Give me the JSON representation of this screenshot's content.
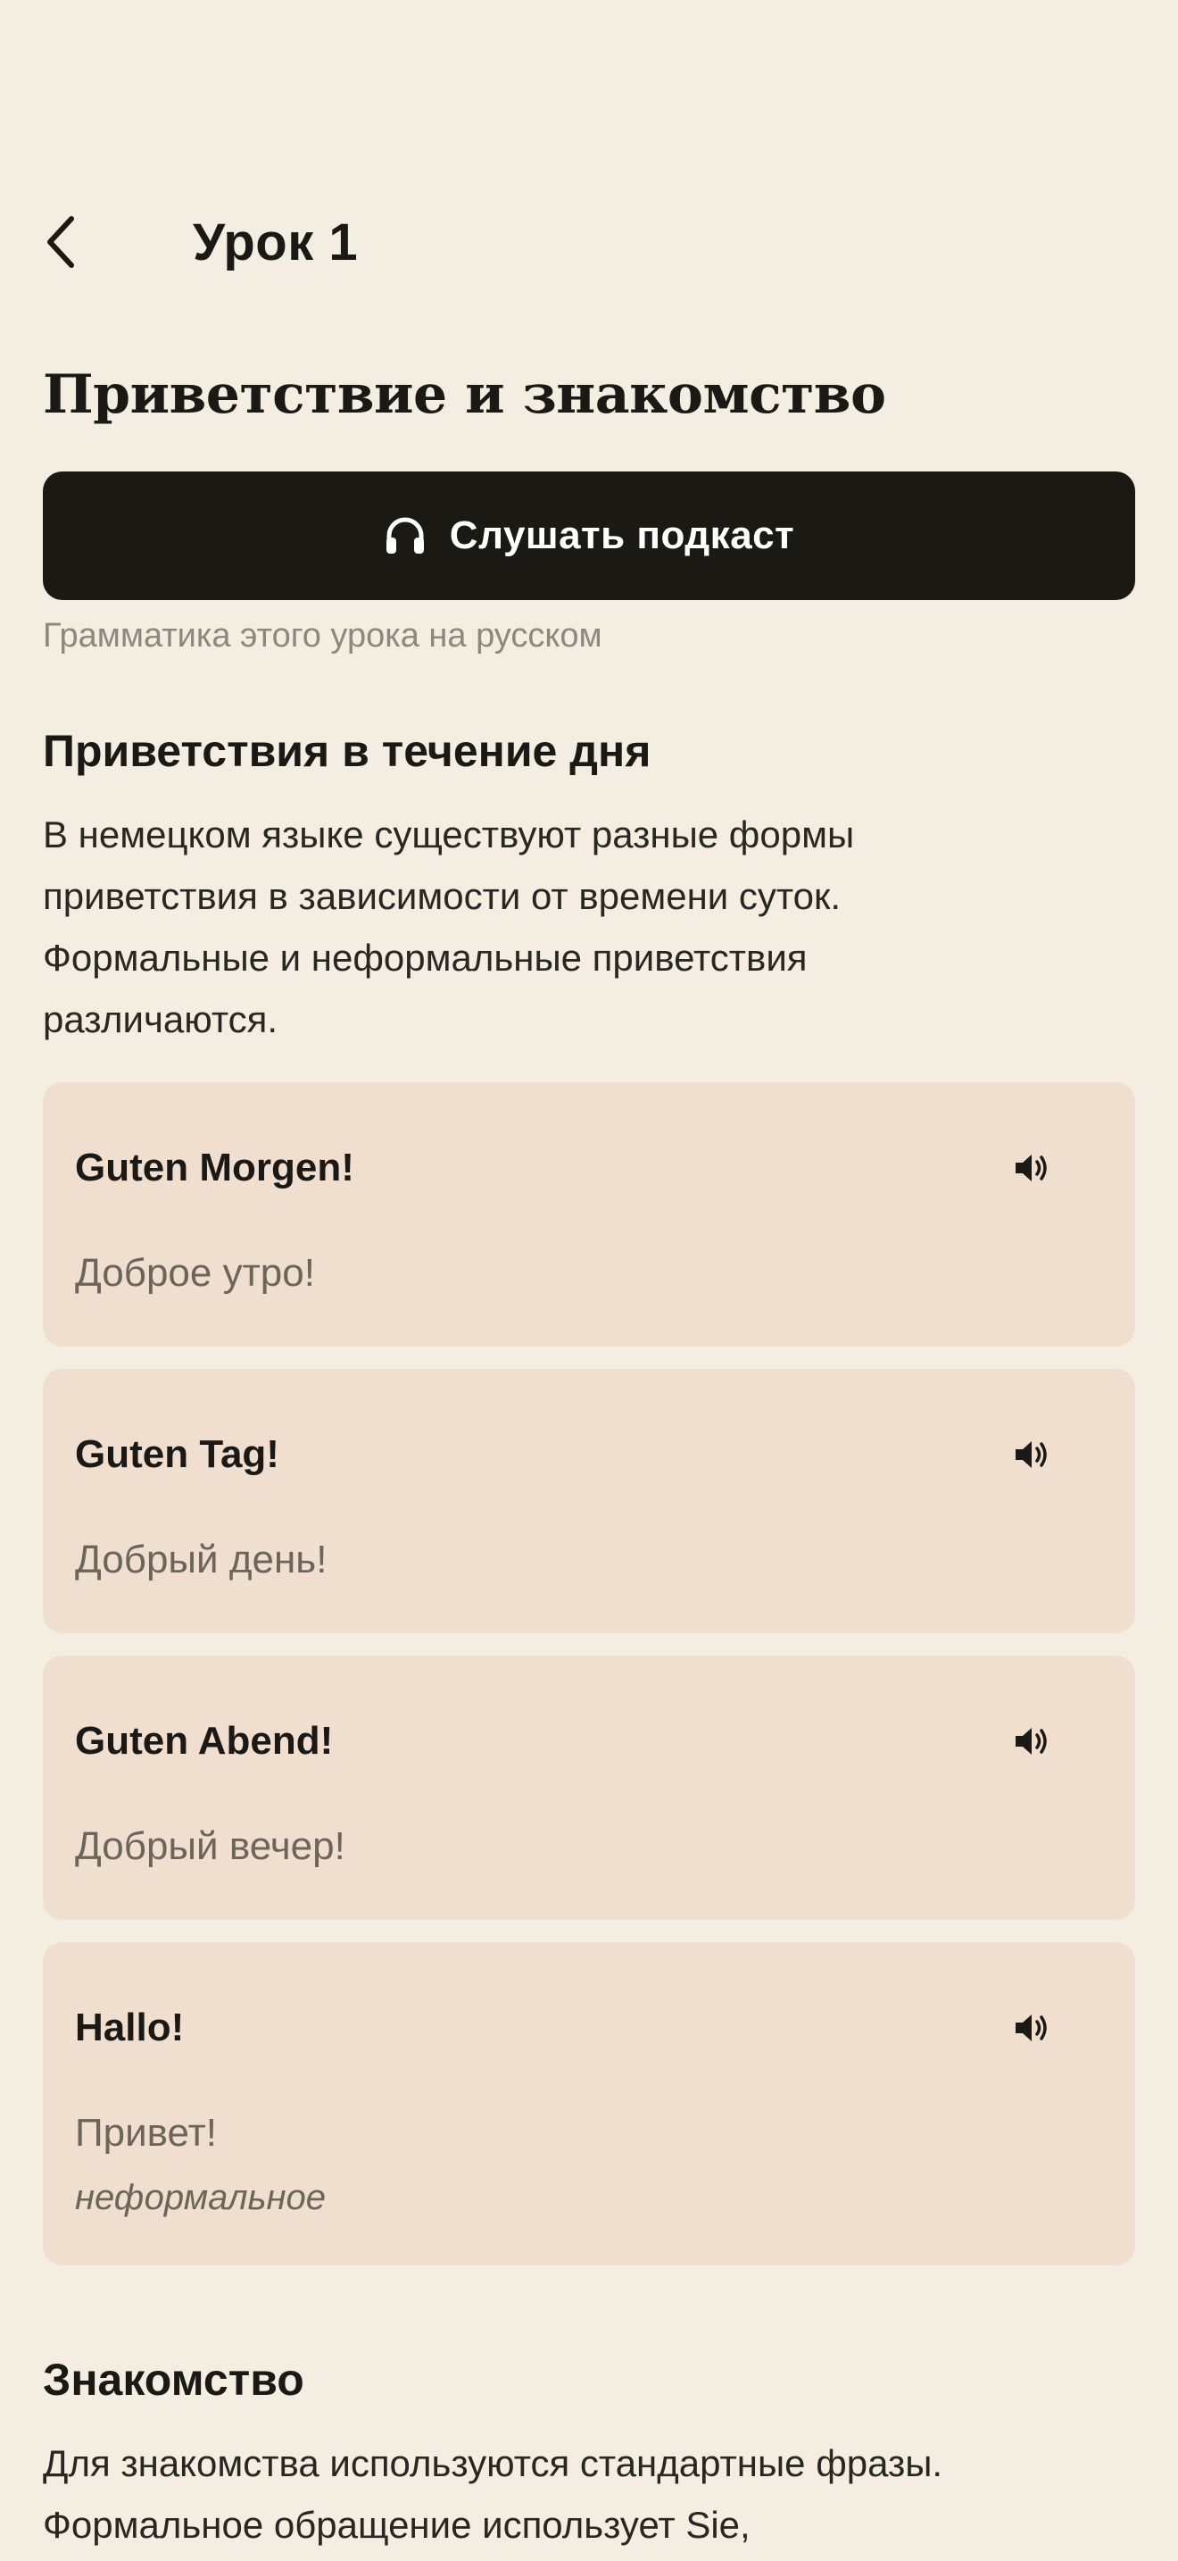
{
  "header": {
    "title": "Урок 1"
  },
  "lesson": {
    "title": "Приветствие и знакомство",
    "podcast_label": "Слушать подкаст",
    "grammar_note": "Грамматика этого урока на русском"
  },
  "sections": [
    {
      "title": "Приветствия в течение дня",
      "text_lines": [
        "В немецком языке существуют разные формы",
        "приветствия в зависимости от времени суток.",
        "Формальные и неформальные приветствия",
        "различаются."
      ]
    },
    {
      "title": "Знакомство",
      "text_lines": [
        "Для знакомства используются стандартные фразы.",
        "Формальное обращение использует Sie,"
      ]
    }
  ],
  "phrases": [
    {
      "de": "Guten Morgen!",
      "ru": "Доброе утро!"
    },
    {
      "de": "Guten Tag!",
      "ru": "Добрый день!"
    },
    {
      "de": "Guten Abend!",
      "ru": "Добрый вечер!"
    },
    {
      "de": "Hallo!",
      "ru": "Привет!",
      "note": "неформальное"
    }
  ],
  "colors": {
    "background": "#F3EDE2",
    "card": "#F0DECE",
    "button": "#1B1914",
    "text": "#1B1915",
    "muted": "#8D877D"
  },
  "icons": {
    "back": "chevron-left-icon",
    "podcast": "headphones-icon",
    "speaker": "speaker-icon"
  }
}
